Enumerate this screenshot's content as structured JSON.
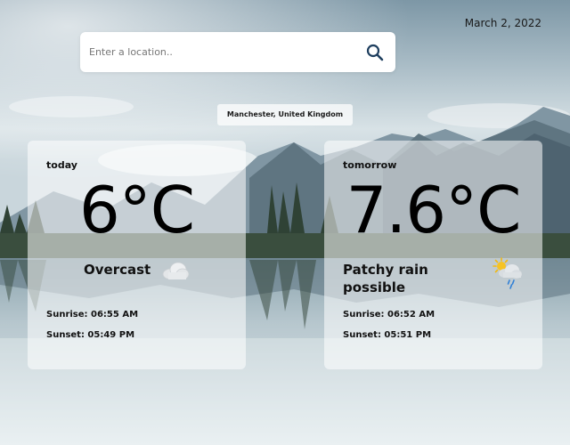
{
  "header": {
    "date": "March 2, 2022"
  },
  "search": {
    "placeholder": "Enter a location..",
    "value": "",
    "icon": "search-icon"
  },
  "location": "Manchester, United Kingdom",
  "today": {
    "label": "today",
    "temperature": "6°C",
    "condition": "Overcast",
    "icon": "cloud-icon",
    "sunrise": "Sunrise: 06:55 AM",
    "sunset": "Sunset: 05:49 PM"
  },
  "tomorrow": {
    "label": "tomorrow",
    "temperature": "7.6°C",
    "condition": "Patchy rain possible",
    "icon": "sun-cloud-rain-icon",
    "sunrise": "Sunrise: 06:52 AM",
    "sunset": "Sunset: 05:51 PM"
  },
  "colors": {
    "card_bg": "#ffffffcc",
    "text": "#111111",
    "search_icon": "#1f3f5f"
  }
}
